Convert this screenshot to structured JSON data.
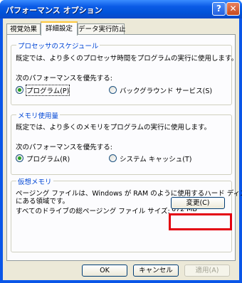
{
  "window": {
    "title": "パフォーマンス オプション",
    "help_label": "?",
    "close_label": "✕"
  },
  "tabs": [
    {
      "label": "視覚効果",
      "selected": false
    },
    {
      "label": "詳細設定",
      "selected": true
    },
    {
      "label": "データ実行防止",
      "selected": false
    }
  ],
  "scheduling": {
    "title": "プロセッサのスケジュール",
    "description": "既定では、より多くのプロセッサ時間をプログラムの実行に使用します。",
    "prompt": "次のパフォーマンスを優先する:",
    "options": [
      {
        "label": "プログラム(P)",
        "selected": true
      },
      {
        "label": "バックグラウンド サービス(S)",
        "selected": false
      }
    ]
  },
  "memory": {
    "title": "メモリ使用量",
    "description": "既定では、より多くのメモリをプログラムの実行に使用します。",
    "prompt": "次のパフォーマンスを優先する:",
    "options": [
      {
        "label": "プログラム(R)",
        "selected": true
      },
      {
        "label": "システム キャッシュ(T)",
        "selected": false
      }
    ]
  },
  "virtual_memory": {
    "title": "仮想メモリ",
    "description_line1": "ページング ファイルは、Windows が RAM のように使用するハード ディスク",
    "description_line2": "にある領域です。",
    "total_label": "すべてのドライブの総ページング ファイル サイズ:",
    "total_value": "672 MB",
    "change_label": "変更(C)"
  },
  "footer": {
    "ok_label": "OK",
    "cancel_label": "キャンセル",
    "apply_label": "適用(A)"
  },
  "colors": {
    "highlight_border": "#e3000f",
    "group_title": "#0046d5",
    "titlebar": "#0052d8"
  }
}
